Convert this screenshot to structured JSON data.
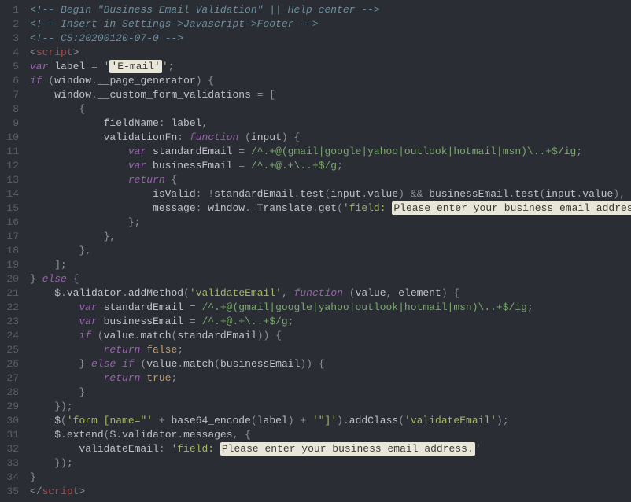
{
  "lines": [
    {
      "tokens": [
        {
          "cls": "c-comment",
          "t": "<!-- Begin \"Business Email Validation\" || Help center -->"
        }
      ]
    },
    {
      "tokens": [
        {
          "cls": "c-comment",
          "t": "<!-- Insert in Settings->Javascript->Footer -->"
        }
      ]
    },
    {
      "tokens": [
        {
          "cls": "c-comment",
          "t": "<!-- CS:20200120-07-0 -->"
        }
      ]
    },
    {
      "tokens": [
        {
          "cls": "c-punct",
          "t": "<"
        },
        {
          "cls": "c-tag",
          "t": "script"
        },
        {
          "cls": "c-punct",
          "t": ">"
        }
      ]
    },
    {
      "tokens": [
        {
          "cls": "c-decl",
          "t": "var"
        },
        {
          "cls": "",
          "t": " label "
        },
        {
          "cls": "c-punct",
          "t": "= "
        },
        {
          "cls": "c-str",
          "t": "'"
        },
        {
          "cls": "hl",
          "t": "'E-mail'"
        },
        {
          "cls": "c-str",
          "t": "'"
        },
        {
          "cls": "c-punct",
          "t": ";"
        }
      ]
    },
    {
      "tokens": [
        {
          "cls": "c-kw",
          "t": "if"
        },
        {
          "cls": "",
          "t": " "
        },
        {
          "cls": "c-punct",
          "t": "("
        },
        {
          "cls": "c-obj",
          "t": "window"
        },
        {
          "cls": "c-punct",
          "t": "."
        },
        {
          "cls": "c-ident",
          "t": "__page_generator"
        },
        {
          "cls": "c-punct",
          "t": ") {"
        }
      ]
    },
    {
      "indent": 1,
      "tokens": [
        {
          "cls": "c-obj",
          "t": "window"
        },
        {
          "cls": "c-punct",
          "t": "."
        },
        {
          "cls": "c-ident",
          "t": "__custom_form_validations "
        },
        {
          "cls": "c-punct",
          "t": "= ["
        }
      ]
    },
    {
      "indent": 2,
      "tokens": [
        {
          "cls": "c-punct",
          "t": "{"
        }
      ]
    },
    {
      "indent": 3,
      "tokens": [
        {
          "cls": "c-ident",
          "t": "fieldName"
        },
        {
          "cls": "c-punct",
          "t": ": "
        },
        {
          "cls": "c-ident",
          "t": "label"
        },
        {
          "cls": "c-punct",
          "t": ","
        }
      ]
    },
    {
      "indent": 3,
      "tokens": [
        {
          "cls": "c-ident",
          "t": "validationFn"
        },
        {
          "cls": "c-punct",
          "t": ": "
        },
        {
          "cls": "c-kw",
          "t": "function"
        },
        {
          "cls": "",
          "t": " "
        },
        {
          "cls": "c-punct",
          "t": "("
        },
        {
          "cls": "c-ident",
          "t": "input"
        },
        {
          "cls": "c-punct",
          "t": ") {"
        }
      ]
    },
    {
      "indent": 4,
      "tokens": [
        {
          "cls": "c-decl",
          "t": "var"
        },
        {
          "cls": "",
          "t": " standardEmail "
        },
        {
          "cls": "c-punct",
          "t": "= "
        },
        {
          "cls": "c-regex",
          "t": "/^.+@(gmail|google|yahoo|outlook|hotmail|msn)\\..+$/ig"
        },
        {
          "cls": "c-punct",
          "t": ";"
        }
      ]
    },
    {
      "indent": 4,
      "tokens": [
        {
          "cls": "c-decl",
          "t": "var"
        },
        {
          "cls": "",
          "t": " businessEmail "
        },
        {
          "cls": "c-punct",
          "t": "= "
        },
        {
          "cls": "c-regex",
          "t": "/^.+@.+\\..+$/g"
        },
        {
          "cls": "c-punct",
          "t": ";"
        }
      ]
    },
    {
      "indent": 4,
      "tokens": [
        {
          "cls": "c-kw",
          "t": "return"
        },
        {
          "cls": "",
          "t": " "
        },
        {
          "cls": "c-punct",
          "t": "{"
        }
      ]
    },
    {
      "indent": 5,
      "tokens": [
        {
          "cls": "c-ident",
          "t": "isValid"
        },
        {
          "cls": "c-punct",
          "t": ": "
        },
        {
          "cls": "c-punct",
          "t": "!"
        },
        {
          "cls": "c-ident",
          "t": "standardEmail"
        },
        {
          "cls": "c-punct",
          "t": "."
        },
        {
          "cls": "c-ident",
          "t": "test"
        },
        {
          "cls": "c-punct",
          "t": "("
        },
        {
          "cls": "c-ident",
          "t": "input"
        },
        {
          "cls": "c-punct",
          "t": "."
        },
        {
          "cls": "c-ident",
          "t": "value"
        },
        {
          "cls": "c-punct",
          "t": ") "
        },
        {
          "cls": "c-punct",
          "t": "&& "
        },
        {
          "cls": "c-ident",
          "t": "businessEmail"
        },
        {
          "cls": "c-punct",
          "t": "."
        },
        {
          "cls": "c-ident",
          "t": "test"
        },
        {
          "cls": "c-punct",
          "t": "("
        },
        {
          "cls": "c-ident",
          "t": "input"
        },
        {
          "cls": "c-punct",
          "t": "."
        },
        {
          "cls": "c-ident",
          "t": "value"
        },
        {
          "cls": "c-punct",
          "t": "),"
        }
      ]
    },
    {
      "indent": 5,
      "tokens": [
        {
          "cls": "c-ident",
          "t": "message"
        },
        {
          "cls": "c-punct",
          "t": ": "
        },
        {
          "cls": "c-obj",
          "t": "window"
        },
        {
          "cls": "c-punct",
          "t": "."
        },
        {
          "cls": "c-ident",
          "t": "_Translate"
        },
        {
          "cls": "c-punct",
          "t": "."
        },
        {
          "cls": "c-ident",
          "t": "get"
        },
        {
          "cls": "c-punct",
          "t": "("
        },
        {
          "cls": "c-str",
          "t": "'field: "
        },
        {
          "cls": "hl",
          "t": "Please enter your business email address."
        },
        {
          "cls": "c-str",
          "t": "'"
        },
        {
          "cls": "c-punct",
          "t": "),"
        }
      ]
    },
    {
      "indent": 4,
      "tokens": [
        {
          "cls": "c-punct",
          "t": "};"
        }
      ]
    },
    {
      "indent": 3,
      "tokens": [
        {
          "cls": "c-punct",
          "t": "},"
        }
      ]
    },
    {
      "indent": 2,
      "tokens": [
        {
          "cls": "c-punct",
          "t": "},"
        }
      ]
    },
    {
      "indent": 1,
      "tokens": [
        {
          "cls": "c-punct",
          "t": "];"
        }
      ]
    },
    {
      "tokens": [
        {
          "cls": "c-punct",
          "t": "} "
        },
        {
          "cls": "c-kw",
          "t": "else"
        },
        {
          "cls": "",
          "t": " "
        },
        {
          "cls": "c-punct",
          "t": "{"
        }
      ]
    },
    {
      "indent": 1,
      "tokens": [
        {
          "cls": "c-ident",
          "t": "$"
        },
        {
          "cls": "c-punct",
          "t": "."
        },
        {
          "cls": "c-ident",
          "t": "validator"
        },
        {
          "cls": "c-punct",
          "t": "."
        },
        {
          "cls": "c-ident",
          "t": "addMethod"
        },
        {
          "cls": "c-punct",
          "t": "("
        },
        {
          "cls": "c-str",
          "t": "'validateEmail'"
        },
        {
          "cls": "c-punct",
          "t": ", "
        },
        {
          "cls": "c-kw",
          "t": "function"
        },
        {
          "cls": "",
          "t": " "
        },
        {
          "cls": "c-punct",
          "t": "("
        },
        {
          "cls": "c-ident",
          "t": "value"
        },
        {
          "cls": "c-punct",
          "t": ", "
        },
        {
          "cls": "c-ident",
          "t": "element"
        },
        {
          "cls": "c-punct",
          "t": ") {"
        }
      ]
    },
    {
      "indent": 2,
      "tokens": [
        {
          "cls": "c-decl",
          "t": "var"
        },
        {
          "cls": "",
          "t": " standardEmail "
        },
        {
          "cls": "c-punct",
          "t": "= "
        },
        {
          "cls": "c-regex",
          "t": "/^.+@(gmail|google|yahoo|outlook|hotmail|msn)\\..+$/ig"
        },
        {
          "cls": "c-punct",
          "t": ";"
        }
      ]
    },
    {
      "indent": 2,
      "tokens": [
        {
          "cls": "c-decl",
          "t": "var"
        },
        {
          "cls": "",
          "t": " businessEmail "
        },
        {
          "cls": "c-punct",
          "t": "= "
        },
        {
          "cls": "c-regex",
          "t": "/^.+@.+\\..+$/g"
        },
        {
          "cls": "c-punct",
          "t": ";"
        }
      ]
    },
    {
      "indent": 2,
      "tokens": [
        {
          "cls": "c-kw",
          "t": "if"
        },
        {
          "cls": "",
          "t": " "
        },
        {
          "cls": "c-punct",
          "t": "("
        },
        {
          "cls": "c-ident",
          "t": "value"
        },
        {
          "cls": "c-punct",
          "t": "."
        },
        {
          "cls": "c-ident",
          "t": "match"
        },
        {
          "cls": "c-punct",
          "t": "("
        },
        {
          "cls": "c-ident",
          "t": "standardEmail"
        },
        {
          "cls": "c-punct",
          "t": ")) {"
        }
      ]
    },
    {
      "indent": 3,
      "tokens": [
        {
          "cls": "c-kw",
          "t": "return"
        },
        {
          "cls": "",
          "t": " "
        },
        {
          "cls": "c-num",
          "t": "false"
        },
        {
          "cls": "c-punct",
          "t": ";"
        }
      ]
    },
    {
      "indent": 2,
      "tokens": [
        {
          "cls": "c-punct",
          "t": "} "
        },
        {
          "cls": "c-kw",
          "t": "else"
        },
        {
          "cls": "",
          "t": " "
        },
        {
          "cls": "c-kw",
          "t": "if"
        },
        {
          "cls": "",
          "t": " "
        },
        {
          "cls": "c-punct",
          "t": "("
        },
        {
          "cls": "c-ident",
          "t": "value"
        },
        {
          "cls": "c-punct",
          "t": "."
        },
        {
          "cls": "c-ident",
          "t": "match"
        },
        {
          "cls": "c-punct",
          "t": "("
        },
        {
          "cls": "c-ident",
          "t": "businessEmail"
        },
        {
          "cls": "c-punct",
          "t": ")) {"
        }
      ]
    },
    {
      "indent": 3,
      "tokens": [
        {
          "cls": "c-kw",
          "t": "return"
        },
        {
          "cls": "",
          "t": " "
        },
        {
          "cls": "c-num",
          "t": "true"
        },
        {
          "cls": "c-punct",
          "t": ";"
        }
      ]
    },
    {
      "indent": 2,
      "tokens": [
        {
          "cls": "c-punct",
          "t": "}"
        }
      ]
    },
    {
      "indent": 1,
      "tokens": [
        {
          "cls": "c-punct",
          "t": "});"
        }
      ]
    },
    {
      "indent": 1,
      "tokens": [
        {
          "cls": "c-ident",
          "t": "$"
        },
        {
          "cls": "c-punct",
          "t": "("
        },
        {
          "cls": "c-str",
          "t": "'form [name=\"'"
        },
        {
          "cls": "",
          "t": " "
        },
        {
          "cls": "c-punct",
          "t": "+ "
        },
        {
          "cls": "c-ident",
          "t": "base64_encode"
        },
        {
          "cls": "c-punct",
          "t": "("
        },
        {
          "cls": "c-ident",
          "t": "label"
        },
        {
          "cls": "c-punct",
          "t": ") "
        },
        {
          "cls": "c-punct",
          "t": "+ "
        },
        {
          "cls": "c-str",
          "t": "'\"]'"
        },
        {
          "cls": "c-punct",
          "t": ")."
        },
        {
          "cls": "c-ident",
          "t": "addClass"
        },
        {
          "cls": "c-punct",
          "t": "("
        },
        {
          "cls": "c-str",
          "t": "'validateEmail'"
        },
        {
          "cls": "c-punct",
          "t": ");"
        }
      ]
    },
    {
      "indent": 1,
      "tokens": [
        {
          "cls": "c-ident",
          "t": "$"
        },
        {
          "cls": "c-punct",
          "t": "."
        },
        {
          "cls": "c-ident",
          "t": "extend"
        },
        {
          "cls": "c-punct",
          "t": "("
        },
        {
          "cls": "c-ident",
          "t": "$"
        },
        {
          "cls": "c-punct",
          "t": "."
        },
        {
          "cls": "c-ident",
          "t": "validator"
        },
        {
          "cls": "c-punct",
          "t": "."
        },
        {
          "cls": "c-ident",
          "t": "messages"
        },
        {
          "cls": "c-punct",
          "t": ", {"
        }
      ]
    },
    {
      "indent": 2,
      "tokens": [
        {
          "cls": "c-ident",
          "t": "validateEmail"
        },
        {
          "cls": "c-punct",
          "t": ": "
        },
        {
          "cls": "c-str",
          "t": "'field: "
        },
        {
          "cls": "hl",
          "t": "Please enter your business email address."
        },
        {
          "cls": "c-str",
          "t": "'"
        }
      ]
    },
    {
      "indent": 1,
      "tokens": [
        {
          "cls": "c-punct",
          "t": "});"
        }
      ]
    },
    {
      "tokens": [
        {
          "cls": "c-punct",
          "t": "}"
        }
      ]
    },
    {
      "tokens": [
        {
          "cls": "c-punct",
          "t": "</"
        },
        {
          "cls": "c-tag",
          "t": "script"
        },
        {
          "cls": "c-punct",
          "t": ">"
        }
      ]
    }
  ]
}
